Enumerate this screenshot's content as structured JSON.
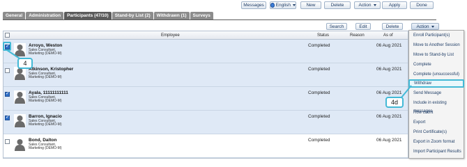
{
  "toolbar": {
    "messages": "Messages",
    "language": "English",
    "new": "New",
    "delete": "Delete",
    "action": "Action",
    "apply": "Apply",
    "done": "Done"
  },
  "tabs": [
    {
      "label": "General"
    },
    {
      "label": "Administration"
    },
    {
      "label": "Participants (47/10)"
    },
    {
      "label": "Stand-by List (2)"
    },
    {
      "label": "Withdrawn (1)"
    },
    {
      "label": "Surveys"
    }
  ],
  "secondary_toolbar": {
    "search": "Search",
    "edit": "Edit",
    "delete": "Delete",
    "action": "Action"
  },
  "table": {
    "headers": {
      "employee": "Employee",
      "status": "Status",
      "reason": "Reason",
      "as_of": "As of"
    },
    "rows": [
      {
        "name": "Arroyo, Weston",
        "line1": "Sales Consultant,",
        "line2": "Marketing (DEMO-M)",
        "status": "Completed",
        "date": "06 Aug 2021",
        "checked": true
      },
      {
        "name": "Atkinson, Kristopher",
        "line1": "Sales Consultant,",
        "line2": "Marketing (DEMO-M)",
        "status": "Completed",
        "date": "06 Aug 2021",
        "checked": false
      },
      {
        "name": "Ayala, 11111111111",
        "line1": "Sales Consultant,",
        "line2": "Marketing (DEMO-M)",
        "status": "Completed",
        "date": "06 Aug 2021",
        "checked": true
      },
      {
        "name": "Barron, Ignacio",
        "line1": "Sales Consultant,",
        "line2": "Marketing (DEMO-M)",
        "status": "Completed",
        "date": "06 Aug 2021",
        "checked": true
      },
      {
        "name": "Bond, Dalton",
        "line1": "Sales Consultant,",
        "line2": "Marketing (DEMO-M)",
        "status": "Completed",
        "date": "06 Aug 2021",
        "checked": false
      }
    ]
  },
  "menu": [
    "Enroll Participant(s)",
    "Move to Another Session",
    "Move to Stand-by List",
    "Complete",
    "Complete (unsuccessful)",
    "Withdraw",
    "Send Message",
    "Include in existing messages",
    "Row count",
    "Export",
    "Print Certificate(s)",
    "Export in Zoom format",
    "Import Participant Results"
  ],
  "callouts": {
    "step_4": "4",
    "step_4d": "4d"
  },
  "colors": {
    "accent": "#43b9d6",
    "selected_row": "#dfe9f6",
    "active_tab": "#5b5b5b"
  }
}
